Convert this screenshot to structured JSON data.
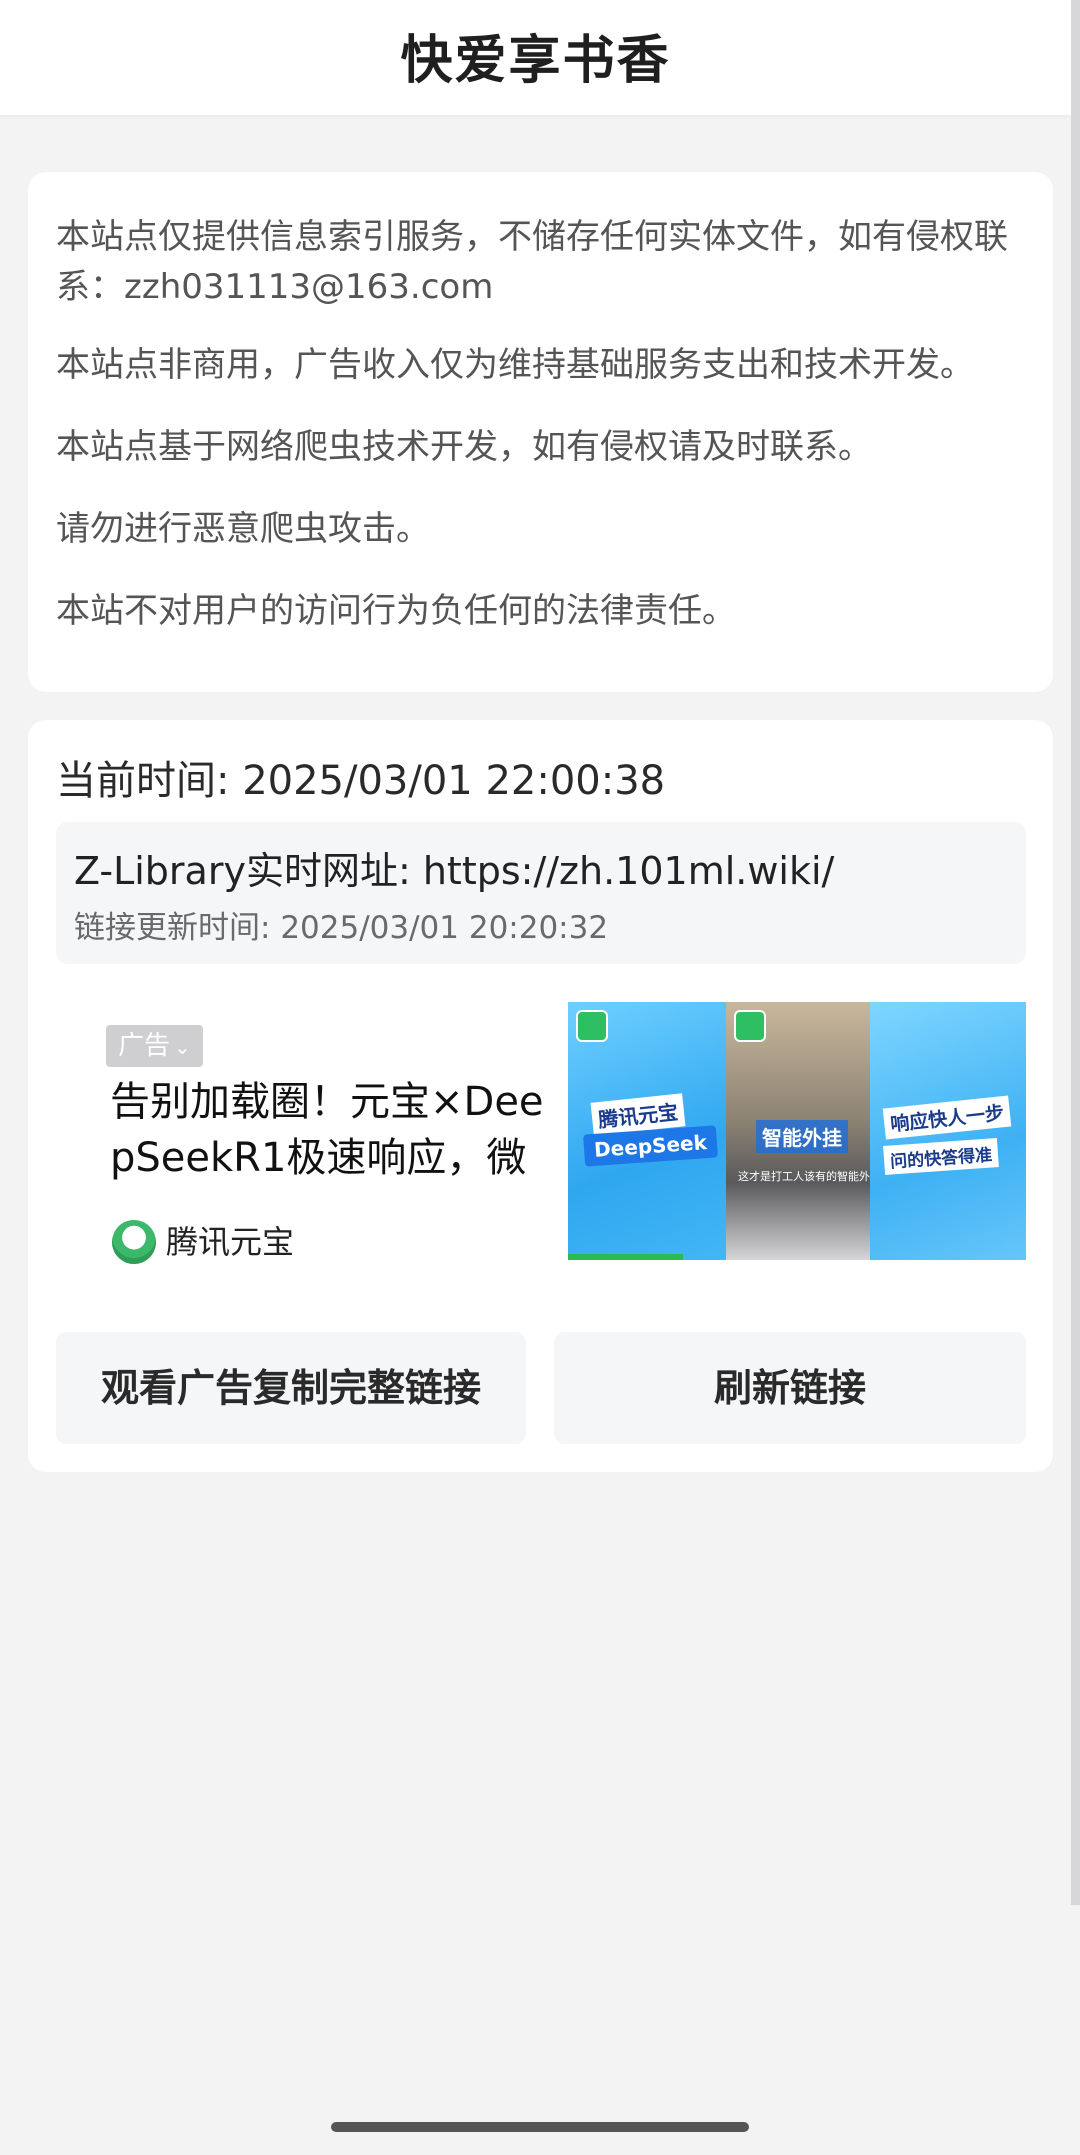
{
  "header": {
    "title": "快爱享书香"
  },
  "notice": {
    "lines": [
      "本站点仅提供信息索引服务，不储存任何实体文件，如有侵权联系：zzh031113@163.com",
      "本站点非商用，广告收入仅为维持基础服务支出和技术开发。",
      "本站点基于网络爬虫技术开发，如有侵权请及时联系。",
      "请勿进行恶意爬虫攻击。",
      "本站不对用户的访问行为负任何的法律责任。"
    ]
  },
  "current_time": {
    "label": "当前时间: ",
    "value": "2025/03/01 22:00:38"
  },
  "zlibrary": {
    "label": "Z-Library实时网址: ",
    "url": "https://zh.101ml.wiki/",
    "update_label": "链接更新时间: ",
    "update_time": "2025/03/01 20:20:32"
  },
  "ad": {
    "badge": "广告",
    "title": "告别加载圈！元宝×DeepSeekR1极速响应，微",
    "advertiser": "腾讯元宝",
    "image_texts": {
      "panel1_tag": "腾讯元宝",
      "panel1_brand": "DeepSeek",
      "panel2_tag": "智能外挂",
      "panel2_sub": "这才是打工人该有的智能外挂",
      "panel3_tag1": "响应快人一步",
      "panel3_tag2": "问的快答得准"
    },
    "progress": 0.25
  },
  "buttons": {
    "watch_ad": "观看广告复制完整链接",
    "refresh": "刷新链接"
  },
  "colors": {
    "background": "#f3f3f4",
    "card": "#ffffff",
    "button_bg": "#f5f6f8",
    "ad_progress": "#2bbb56"
  }
}
